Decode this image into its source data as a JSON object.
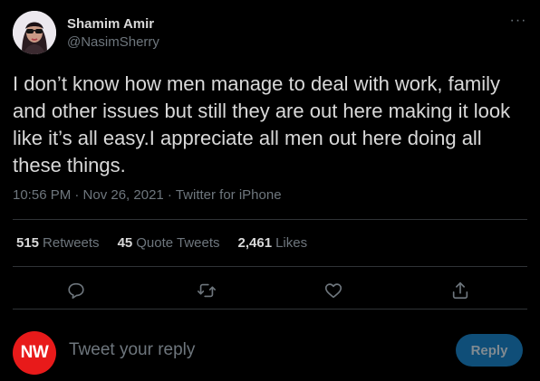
{
  "user": {
    "display_name": "Shamim Amir",
    "handle": "@NasimSherry"
  },
  "tweet": {
    "text": "I don’t know how men manage to deal with work, family and other issues but still they are out here making it look like it’s all easy.I appreciate all men out here doing all these things.",
    "timestamp": "10:56 PM · Nov 26, 2021 · Twitter for iPhone"
  },
  "stats": {
    "retweets_count": "515",
    "retweets_label": "Retweets",
    "quotes_count": "45",
    "quotes_label": "Quote Tweets",
    "likes_count": "2,461",
    "likes_label": "Likes"
  },
  "actions": [
    "reply-icon",
    "retweet-icon",
    "like-icon",
    "share-icon"
  ],
  "reply_box": {
    "avatar_text": "NW",
    "placeholder": "Tweet your reply",
    "button_label": "Reply"
  },
  "colors": {
    "background": "#000000",
    "text": "#d9d9d9",
    "muted": "#6e767d",
    "divider": "#2f3336",
    "reply_button": "#0f4e78",
    "avatar_red": "#e81a1a"
  }
}
